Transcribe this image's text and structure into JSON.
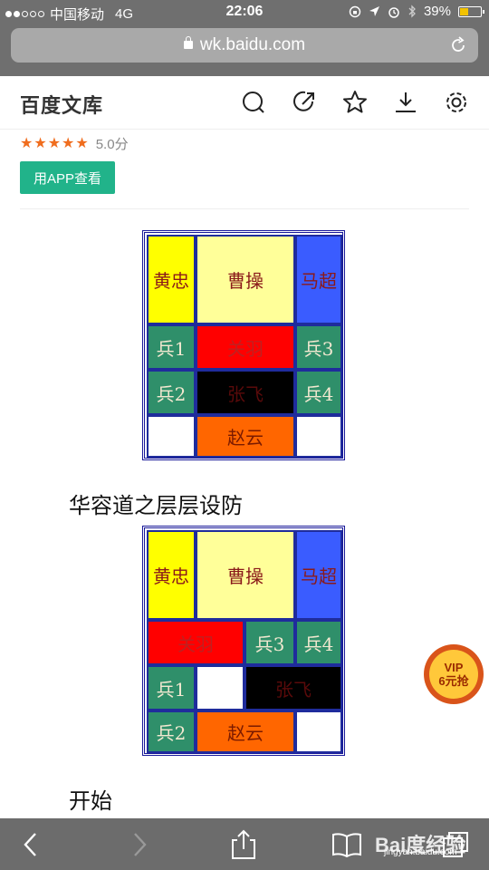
{
  "status_bar": {
    "carrier": "中国移动",
    "network": "4G",
    "time": "22:06",
    "battery": "39%",
    "battery_level": 0.39
  },
  "browser": {
    "url": "wk.baidu.com"
  },
  "header": {
    "title": "百度文库",
    "icons": [
      "search-icon",
      "share-icon",
      "star-icon",
      "download-icon",
      "settings-icon"
    ]
  },
  "rating": {
    "stars": 5,
    "score": "5.0分"
  },
  "app_button": "用APP查看",
  "board1": {
    "cells": {
      "huangzhong": "黄忠",
      "caocao": "曹操",
      "machao": "马超",
      "bing1": "兵1",
      "guanyu": "关羽",
      "bing3": "兵3",
      "bing2": "兵2",
      "zhangfei": "张飞",
      "bing4": "兵4",
      "zhaoyun": "赵云"
    }
  },
  "caption1": "华容道之层层设防",
  "board2": {
    "cells": {
      "huangzhong": "黄忠",
      "caocao": "曹操",
      "machao": "马超",
      "guanyu": "关羽",
      "bing3": "兵3",
      "bing4": "兵4",
      "bing1": "兵1",
      "zhangfei": "张飞",
      "bing2": "兵2",
      "zhaoyun": "赵云"
    }
  },
  "caption2": "开始",
  "vip": {
    "line1": "VIP",
    "line2": "6元抢"
  },
  "watermark": {
    "main": "Bai度经验",
    "sub": "jingyan.baidu.com"
  },
  "colors": {
    "accent_green": "#21b38a",
    "star_orange": "#f06d1e",
    "chrome_gray": "#6f6f6f"
  }
}
